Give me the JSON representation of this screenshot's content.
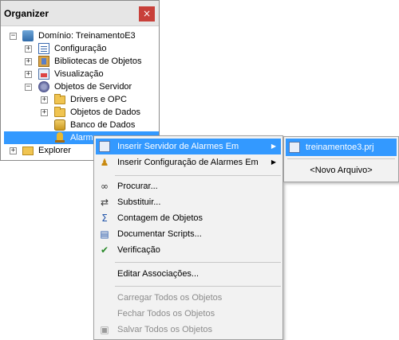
{
  "organizer": {
    "title": "Organizer",
    "close_glyph": "×",
    "tree": [
      {
        "label": "Domínio: TreinamentoE3",
        "expander": "−",
        "icon": "domain-icon"
      },
      {
        "label": "Configuração",
        "expander": "+",
        "icon": "config-icon"
      },
      {
        "label": "Bibliotecas de Objetos",
        "expander": "+",
        "icon": "library-icon"
      },
      {
        "label": "Visualização",
        "expander": "+",
        "icon": "display-icon"
      },
      {
        "label": "Objetos de Servidor",
        "expander": "−",
        "icon": "server-objects-icon"
      },
      {
        "label": "Drivers e OPC",
        "expander": "+",
        "icon": "folder-icon"
      },
      {
        "label": "Objetos de Dados",
        "expander": "+",
        "icon": "folder-icon"
      },
      {
        "label": "Banco de Dados",
        "expander": "",
        "icon": "database-icon"
      },
      {
        "label": "Alarmes",
        "expander": "",
        "icon": "alarm-icon"
      },
      {
        "label": "Explorer",
        "expander": "+",
        "icon": "folder-icon"
      }
    ]
  },
  "context_menu": {
    "items": [
      {
        "label": "Inserir Servidor de Alarmes Em",
        "icon": "insert-server-icon",
        "arrow": "▶"
      },
      {
        "label": "Inserir Configuração de Alarmes Em",
        "icon": "insert-config-icon",
        "arrow": "▶"
      },
      {
        "label": "Procurar...",
        "icon": "binoculars-icon"
      },
      {
        "label": "Substituir...",
        "icon": "replace-icon"
      },
      {
        "label": "Contagem de Objetos",
        "icon": "sigma-icon"
      },
      {
        "label": "Documentar Scripts...",
        "icon": "book-icon"
      },
      {
        "label": "Verificação",
        "icon": "check-icon"
      },
      {
        "label": "Editar Associações...",
        "icon": ""
      },
      {
        "label": "Carregar Todos os Objetos",
        "icon": ""
      },
      {
        "label": "Fechar Todos os Objetos",
        "icon": ""
      },
      {
        "label": "Salvar Todos os Objetos",
        "icon": "save-all-icon"
      }
    ]
  },
  "submenu": {
    "items": [
      {
        "label": "treinamentoe3.prj",
        "icon": "project-icon"
      },
      {
        "label": "<Novo Arquivo>"
      }
    ]
  },
  "colors": {
    "selection": "#3399ff",
    "close_button": "#c8403a",
    "disabled_text": "#8c8c8c"
  }
}
